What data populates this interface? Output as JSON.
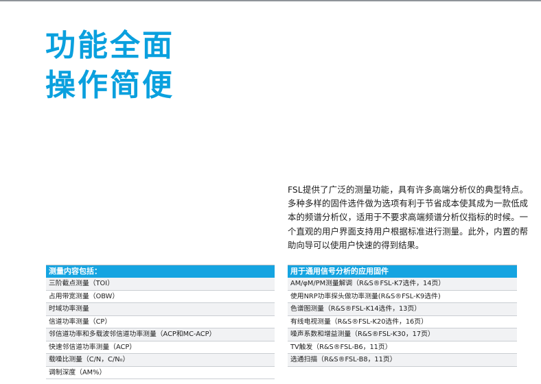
{
  "headline": {
    "line1": "功能全面",
    "line2": "操作简便"
  },
  "intro": {
    "text": "FSL提供了广泛的测量功能，具有许多高端分析仪的典型特点。多种多样的固件选件做为选项有利于节省成本使其成为一款低成本的频谱分析仪，适用于不要求高端频谱分析仪指标的时候。一个直观的用户界面支持用户根据标准进行测量。此外，内置的帮助向导可以使用户快速的得到结果。"
  },
  "measurements_table": {
    "header": "测量内容包括：",
    "rows": [
      "三阶截点测量（TOI）",
      "占用带宽测量（OBW）",
      "时域功率测量",
      "信道功率测量（CP）",
      "邻信道功率和多载波邻信道功率测量（ACP和MC-ACP）",
      "快速邻信道功率测量（ACP）",
      "载噪比测量（C/N，C/N₀）",
      "调制深度（AM%）"
    ]
  },
  "firmware_table": {
    "header": "用于通用信号分析的应用固件",
    "rows": [
      "AM/φM/PM测量解调（R&S®FSL-K7选件，14页）",
      "使用NRP功率探头做功率测量(R&S®FSL-K9选件)",
      "色谱图测量（R&S®FSL-K14选件，13页）",
      "有线电视测量（R&S®FSL-K20选件，16页）",
      "噪声系数和增益测量（R&S®FSL-K30，17页）",
      "TV触发（R&S®FSL-B6，11页）",
      "选通扫描（R&S®FSL-B8，11页）"
    ]
  }
}
